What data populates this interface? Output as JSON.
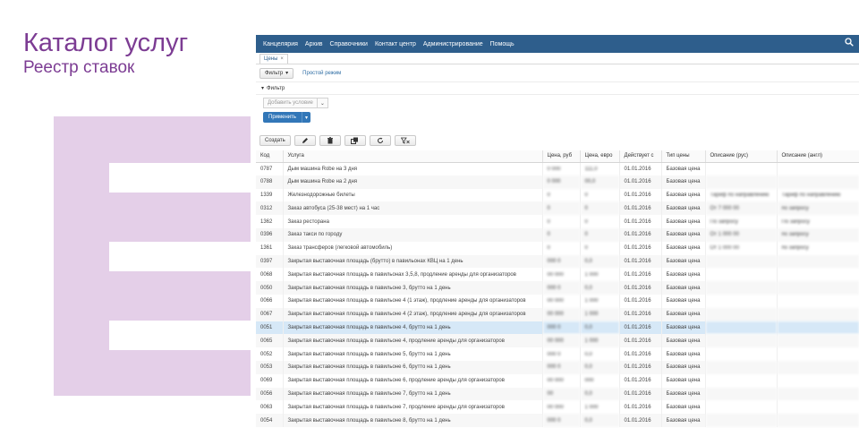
{
  "slide": {
    "title": "Каталог услуг",
    "subtitle": "Реестр ставок",
    "accent": "#7c3c93",
    "decor": "#e4cfe8"
  },
  "menu": [
    "Канцелярия",
    "Архив",
    "Справочники",
    "Контакт центр",
    "Администрирование",
    "Помощь"
  ],
  "search_icon": "magnifier-icon",
  "tab": {
    "label": "Цены",
    "close": "×"
  },
  "toolbar": {
    "filter_label": "Фильтр",
    "simple_mode": "Простой режим"
  },
  "filter": {
    "header": "Фильтр",
    "add_condition_placeholder": "Добавить условие",
    "apply_label": "Применить"
  },
  "actions": {
    "create_label": "Создать"
  },
  "table": {
    "columns": [
      "Код",
      "Услуга",
      "Цена, руб",
      "Цена, евро",
      "Действует с",
      "Тип цены",
      "Описание (рус)",
      "Описание (англ)"
    ],
    "rows": [
      [
        "0787",
        "Дым машина Robe на 3 дня",
        "0 000",
        "111,0",
        "01.01.2016",
        "Базовая цена",
        "",
        ""
      ],
      [
        "0788",
        "Дым машина Robe на 2 дня",
        "0 000",
        "00,0",
        "01.01.2016",
        "Базовая цена",
        "",
        ""
      ],
      [
        "1339",
        "Железнодорожные билеты",
        "0",
        "0",
        "01.01.2016",
        "Базовая цена",
        "Тариф по направлению",
        "Тариф по направлению"
      ],
      [
        "0312",
        "Заказ автобуса (25-38 мест) на 1 час",
        "0",
        "0",
        "01.01.2016",
        "Базовая цена",
        "От 7 000 00",
        "по запросу"
      ],
      [
        "1362",
        "Заказ ресторана",
        "0",
        "0",
        "01.01.2016",
        "Базовая цена",
        "По запросу",
        "По запросу"
      ],
      [
        "0396",
        "Заказ такси по городу",
        "0",
        "0",
        "01.01.2016",
        "Базовая цена",
        "От 1 000 00",
        "по запросу"
      ],
      [
        "1361",
        "Заказ трансферов (легковой автомобиль)",
        "0",
        "0",
        "01.01.2016",
        "Базовая цена",
        "От 1 000 00",
        "по запросу"
      ],
      [
        "0397",
        "Закрытая выставочная площадь (брутто) в павильонах КВЦ на 1 день",
        "000 0",
        "0,0",
        "01.01.2016",
        "Базовая цена",
        "",
        ""
      ],
      [
        "0068",
        "Закрытая выставочная площадь в павильонах 3,5,8, продление аренды для организаторов",
        "00 000",
        "1 000",
        "01.01.2016",
        "Базовая цена",
        "",
        ""
      ],
      [
        "0050",
        "Закрытая выставочная площадь в павильоне 3, брутто на 1 день",
        "000 0",
        "0,0",
        "01.01.2016",
        "Базовая цена",
        "",
        ""
      ],
      [
        "0066",
        "Закрытая выставочная площадь в павильоне 4 (1 этаж), продление аренды для организаторов",
        "00 000",
        "1 000",
        "01.01.2016",
        "Базовая цена",
        "",
        ""
      ],
      [
        "0067",
        "Закрытая выставочная площадь в павильоне 4 (2 этаж), продление аренды для организаторов",
        "00 000",
        "1 000",
        "01.01.2016",
        "Базовая цена",
        "",
        ""
      ],
      [
        "0051",
        "Закрытая выставочная площадь в павильоне 4, брутто на 1 день",
        "000 0",
        "0,0",
        "01.01.2016",
        "Базовая цена",
        "",
        ""
      ],
      [
        "0065",
        "Закрытая выставочная площадь в павильоне 4, продление аренды для организаторов",
        "00 000",
        "1 000",
        "01.01.2016",
        "Базовая цена",
        "",
        ""
      ],
      [
        "0052",
        "Закрытая выставочная площадь в павильоне 5, брутто на 1 день",
        "000 0",
        "0,0",
        "01.01.2016",
        "Базовая цена",
        "",
        ""
      ],
      [
        "0053",
        "Закрытая выставочная площадь в павильоне 6, брутто на 1 день",
        "000 0",
        "0,0",
        "01.01.2016",
        "Базовая цена",
        "",
        ""
      ],
      [
        "0069",
        "Закрытая выставочная площадь в павильоне 6, продление аренды для организаторов",
        "00 000",
        "000",
        "01.01.2016",
        "Базовая цена",
        "",
        ""
      ],
      [
        "0056",
        "Закрытая выставочная площадь в павильоне 7, брутто на 1 день",
        "00",
        "0,0",
        "01.01.2016",
        "Базовая цена",
        "",
        ""
      ],
      [
        "0063",
        "Закрытая выставочная площадь в павильоне 7, продление аренды для организаторов",
        "00 000",
        "1 000",
        "01.01.2016",
        "Базовая цена",
        "",
        ""
      ],
      [
        "0054",
        "Закрытая выставочная площадь в павильоне 8, брутто на 1 день",
        "000 0",
        "0,0",
        "01.01.2016",
        "Базовая цена",
        "",
        ""
      ]
    ],
    "selected_row": 12
  }
}
